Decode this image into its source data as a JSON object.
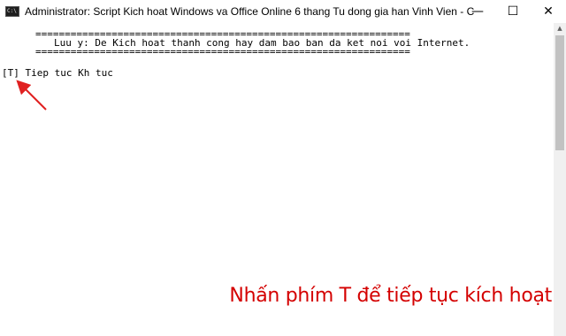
{
  "window": {
    "title": "Administrator:  Script Kich hoat Windows va Office Online 6 thang Tu dong gia han Vinh Vien - Copyright (C) All rights...",
    "icon_text": "C:\\",
    "controls": {
      "minimize": "—",
      "maximize": "☐",
      "close": "✕"
    }
  },
  "console": {
    "separator_top": "================================================================",
    "notice": "Luu y: De Kich hoat thanh cong hay dam bao ban da ket noi voi Internet.",
    "separator_bottom": "================================================================",
    "prompt": "[T] Tiep tuc Kh tuc"
  },
  "caption": {
    "text": "Nhấn phím T để tiếp tục kích hoạt",
    "color": "#d40000"
  },
  "annotation": {
    "arrow_color": "#e02020"
  }
}
